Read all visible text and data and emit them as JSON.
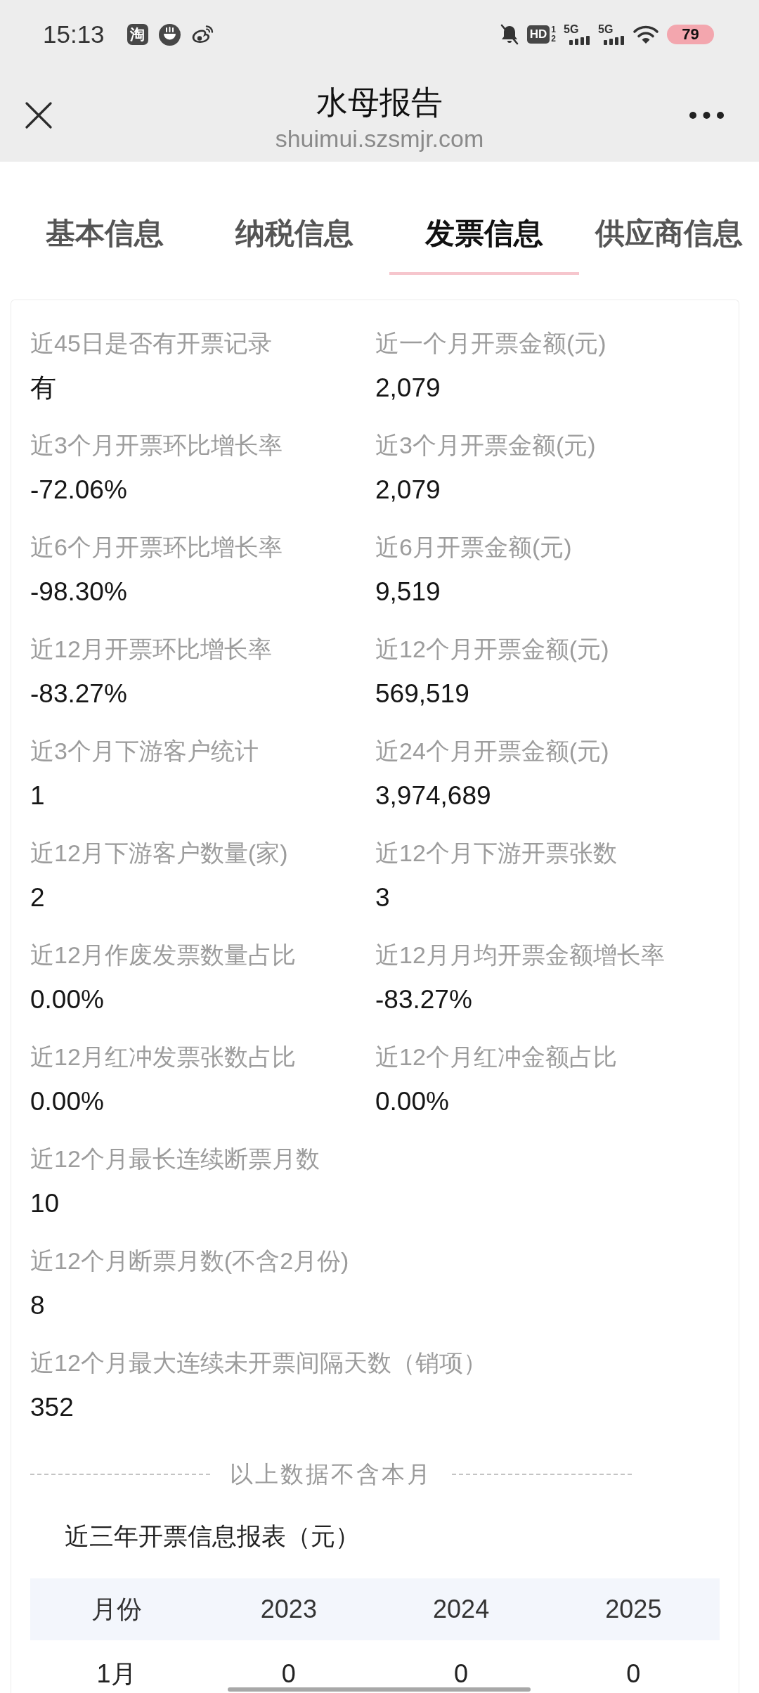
{
  "status_bar": {
    "time": "15:13",
    "app_icons": [
      {
        "kind": "glyph",
        "glyph": "淘"
      },
      {
        "kind": "bowl"
      },
      {
        "kind": "swirl"
      }
    ],
    "hd": {
      "label": "HD",
      "slots": [
        "1",
        "2"
      ]
    },
    "networks": [
      {
        "label": "5G"
      },
      {
        "label": "5G"
      }
    ],
    "battery": "79"
  },
  "header": {
    "title": "水母报告",
    "url": "shuimui.szsmjr.com"
  },
  "tabs": [
    {
      "label": "基本信息",
      "selected": false
    },
    {
      "label": "纳税信息",
      "selected": false
    },
    {
      "label": "发票信息",
      "selected": true
    },
    {
      "label": "供应商信息",
      "selected": false
    }
  ],
  "metrics": [
    {
      "kind": "half",
      "label": "近45日是否有开票记录",
      "value": "有"
    },
    {
      "kind": "half",
      "label": "近一个月开票金额(元)",
      "value": "2,079"
    },
    {
      "kind": "half",
      "label": "近3个月开票环比增长率",
      "value": "-72.06%"
    },
    {
      "kind": "half",
      "label": "近3个月开票金额(元)",
      "value": "2,079"
    },
    {
      "kind": "half",
      "label": "近6个月开票环比增长率",
      "value": "-98.30%"
    },
    {
      "kind": "half",
      "label": "近6月开票金额(元)",
      "value": "9,519"
    },
    {
      "kind": "half",
      "label": "近12月开票环比增长率",
      "value": "-83.27%"
    },
    {
      "kind": "half",
      "label": "近12个月开票金额(元)",
      "value": "569,519"
    },
    {
      "kind": "half",
      "label": "近3个月下游客户统计",
      "value": "1"
    },
    {
      "kind": "half",
      "label": "近24个月开票金额(元)",
      "value": "3,974,689"
    },
    {
      "kind": "half",
      "label": "近12月下游客户数量(家)",
      "value": "2"
    },
    {
      "kind": "half",
      "label": "近12个月下游开票张数",
      "value": "3"
    },
    {
      "kind": "half",
      "label": "近12月作废发票数量占比",
      "value": "0.00%"
    },
    {
      "kind": "half",
      "label": "近12月月均开票金额增长率",
      "value": "-83.27%"
    },
    {
      "kind": "half",
      "label": "近12月红冲发票张数占比",
      "value": "0.00%"
    },
    {
      "kind": "half",
      "label": "近12个月红冲金额占比",
      "value": "0.00%"
    },
    {
      "kind": "wide",
      "label": "近12个月最长连续断票月数",
      "value": "10"
    },
    {
      "kind": "wide",
      "label": "近12个月断票月数(不含2月份)",
      "value": "8"
    },
    {
      "kind": "wide",
      "label": "近12个月最大连续未开票间隔天数（销项）",
      "value": "352"
    }
  ],
  "note": "以上数据不含本月",
  "report": {
    "title": "近三年开票信息报表（元）",
    "columns": [
      "月份",
      "2023",
      "2024",
      "2025"
    ],
    "rows": [
      [
        "1月",
        "0",
        "0",
        "0"
      ]
    ]
  }
}
